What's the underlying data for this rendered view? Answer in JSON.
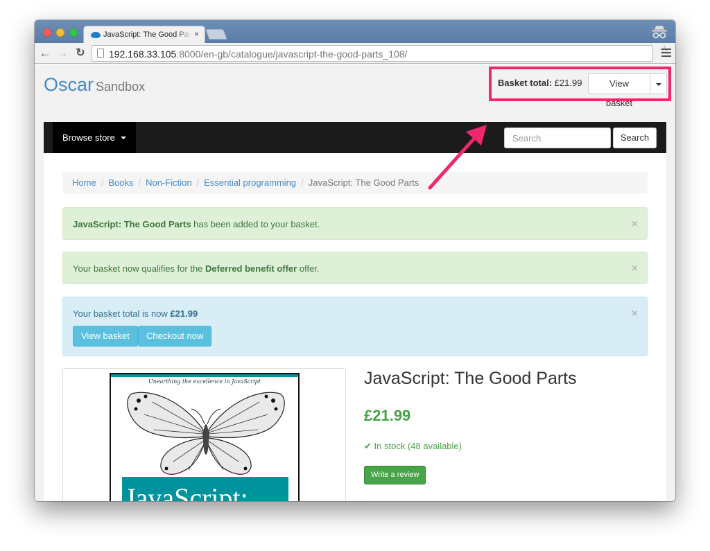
{
  "browser": {
    "tab_title": "JavaScript: The Good Parts",
    "tab_close": "×",
    "url_host": "192.168.33.105",
    "url_rest": ":8000/en-gb/catalogue/javascript-the-good-parts_108/"
  },
  "header": {
    "brand_name": "Oscar",
    "brand_sub": "Sandbox",
    "basket_total_label": "Basket total:",
    "basket_total_value": "£21.99",
    "view_basket_label": "View basket"
  },
  "navbar": {
    "browse_label": "Browse store",
    "search_placeholder": "Search",
    "search_button": "Search"
  },
  "breadcrumb": {
    "items": [
      "Home",
      "Books",
      "Non-Fiction",
      "Essential programming"
    ],
    "active": "JavaScript: The Good Parts",
    "separator": "/"
  },
  "alerts": {
    "added_strong": "JavaScript: The Good Parts",
    "added_rest": " has been added to your basket.",
    "offer_pre": "Your basket now qualifies for the ",
    "offer_strong": "Deferred benefit offer",
    "offer_post": " offer.",
    "total_pre": "Your basket total is now ",
    "total_strong": "£21.99",
    "view_basket_button": "View basket",
    "checkout_button": "Checkout now",
    "close": "×"
  },
  "product": {
    "cover_tagline": "Unearthing the excellence in JavaScript",
    "cover_title": "JavaScript:",
    "title": "JavaScript: The Good Parts",
    "price": "£21.99",
    "stock_check": "✔",
    "stock": "In stock (48 available)",
    "review_button": "Write a review"
  },
  "colors": {
    "link": "#428bca",
    "highlight": "#f0266e",
    "success_text": "#3c763d",
    "price": "#47a447",
    "info_button": "#5bc0de"
  }
}
